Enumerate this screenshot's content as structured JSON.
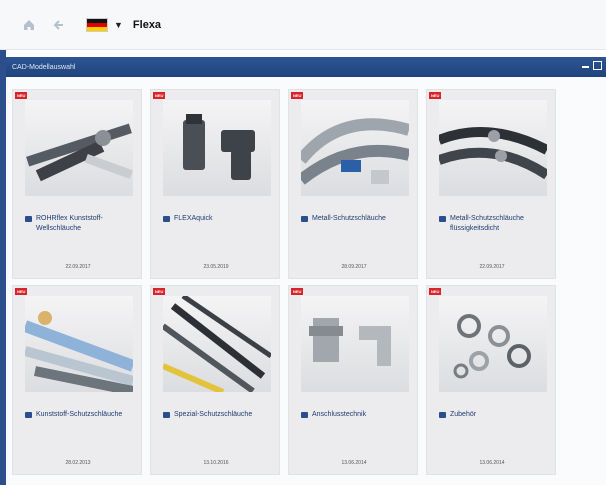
{
  "toolbar": {
    "home_icon": "home-icon",
    "back_icon": "arrow-left-icon",
    "language_flag": "germany-flag",
    "caret_icon": "chevron-down-icon",
    "title": "Flexa"
  },
  "window": {
    "title": "CAD-Modellauswahl"
  },
  "colors": {
    "accent": "#2a4f8c",
    "badge": "#d8232a"
  },
  "cards": [
    {
      "badge": "NEU",
      "label": "ROHRflex Kunststoff-Wellschläuche",
      "date": "22.09.2017"
    },
    {
      "badge": "NEU",
      "label": "FLEXAquick",
      "date": "23.05.2019"
    },
    {
      "badge": "NEU",
      "label": "Metall-Schutzschläuche",
      "date": "28.09.2017"
    },
    {
      "badge": "NEU",
      "label": "Metall-Schutzschläuche flüssigkeitsdicht",
      "date": "22.09.2017"
    },
    {
      "badge": "NEU",
      "label": "Kunststoff-Schutzschläuche",
      "date": "28.02.2013"
    },
    {
      "badge": "NEU",
      "label": "Spezial-Schutzschläuche",
      "date": "13.10.2016"
    },
    {
      "badge": "NEU",
      "label": "Anschlusstechnik",
      "date": "13.06.2014"
    },
    {
      "badge": "NEU",
      "label": "Zubehör",
      "date": "13.06.2014"
    }
  ]
}
